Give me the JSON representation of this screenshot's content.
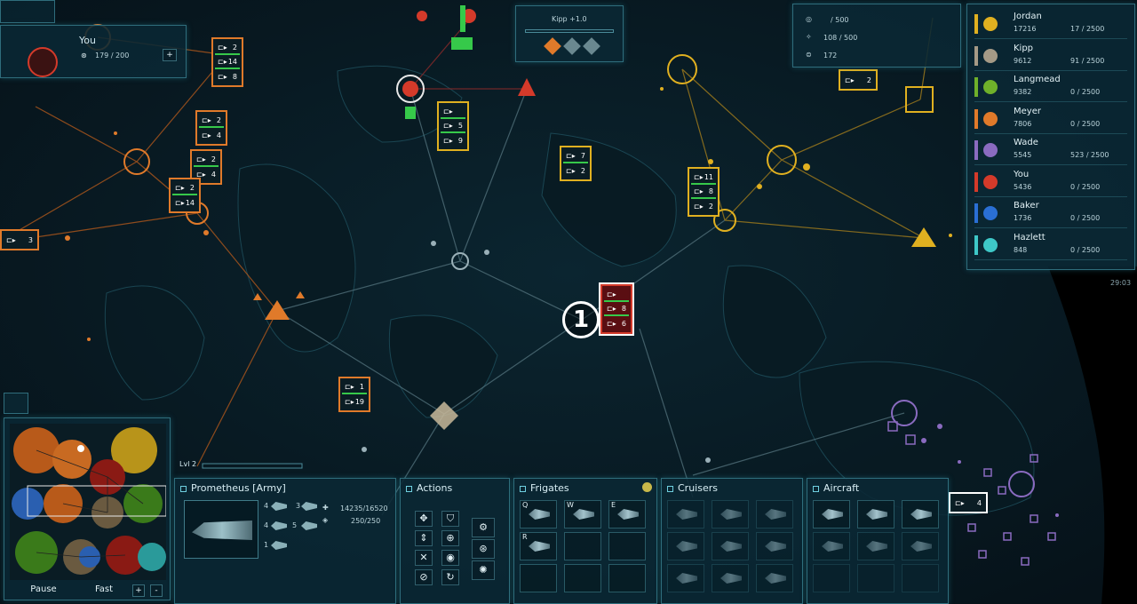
{
  "player": {
    "label": "You",
    "supply": "179 / 200",
    "plus": "+"
  },
  "kipp_bar": {
    "label": "Kipp +1.0"
  },
  "resources": {
    "r1": "/ 500",
    "r2": "108 / 500",
    "r3": "172"
  },
  "players": [
    {
      "name": "Jordan",
      "score": "17216",
      "cap": "17 / 2500",
      "color": "#e0b020"
    },
    {
      "name": "Kipp",
      "score": "9612",
      "cap": "91 / 2500",
      "color": "#a59a86"
    },
    {
      "name": "Langmead",
      "score": "9382",
      "cap": "0 / 2500",
      "color": "#6fb02a"
    },
    {
      "name": "Meyer",
      "score": "7806",
      "cap": "0 / 2500",
      "color": "#e07a2a"
    },
    {
      "name": "Wade",
      "score": "5545",
      "cap": "523 / 2500",
      "color": "#8a6bc0"
    },
    {
      "name": "You",
      "score": "5436",
      "cap": "0 / 2500",
      "color": "#d43a2a"
    },
    {
      "name": "Baker",
      "score": "1736",
      "cap": "0 / 2500",
      "color": "#2a6fd4"
    },
    {
      "name": "Hazlett",
      "score": "848",
      "cap": "0 / 2500",
      "color": "#3ec8c8"
    }
  ],
  "clock": "29:03",
  "marker": "1",
  "level": "Lvl 2",
  "stacks": [
    {
      "id": "s1",
      "rows": [
        "2",
        "14",
        "8"
      ]
    },
    {
      "id": "s2",
      "rows": [
        "2",
        "4"
      ]
    },
    {
      "id": "s3",
      "rows": [
        "2",
        "4"
      ]
    },
    {
      "id": "s4",
      "rows": [
        "2",
        "14"
      ]
    },
    {
      "id": "s5",
      "rows": [
        "3"
      ]
    },
    {
      "id": "s6",
      "rows": [
        "",
        "5",
        "9"
      ]
    },
    {
      "id": "s7",
      "rows": [
        "7",
        "2"
      ]
    },
    {
      "id": "s8",
      "rows": [
        "11",
        "8",
        "2"
      ]
    },
    {
      "id": "s9",
      "rows": [
        "",
        "8",
        "6"
      ]
    },
    {
      "id": "s10",
      "rows": [
        "1",
        "19"
      ]
    },
    {
      "id": "s11",
      "rows": [
        "2"
      ]
    },
    {
      "id": "s12",
      "rows": [
        "4"
      ]
    }
  ],
  "minimap": {
    "pause": "Pause",
    "fast": "Fast",
    "plus": "+",
    "minus": "-"
  },
  "unit": {
    "title": "Prometheus [Army]",
    "hp": "14235/16520",
    "shield": "250/250",
    "c1": "4",
    "c2": "3",
    "c3": "4",
    "c4": "5",
    "c5": "1"
  },
  "actions": {
    "title": "Actions"
  },
  "frigates": {
    "title": "Frigates",
    "k1": "Q",
    "k2": "W",
    "k3": "E",
    "k4": "R"
  },
  "cruisers": {
    "title": "Cruisers"
  },
  "aircraft": {
    "title": "Aircraft"
  },
  "colors": {
    "accent": "#2f6d7c",
    "orange": "#e07a2a",
    "yellow": "#e0b020",
    "red": "#d43a2a",
    "purple": "#8a6bc0",
    "green": "#36c94a"
  }
}
